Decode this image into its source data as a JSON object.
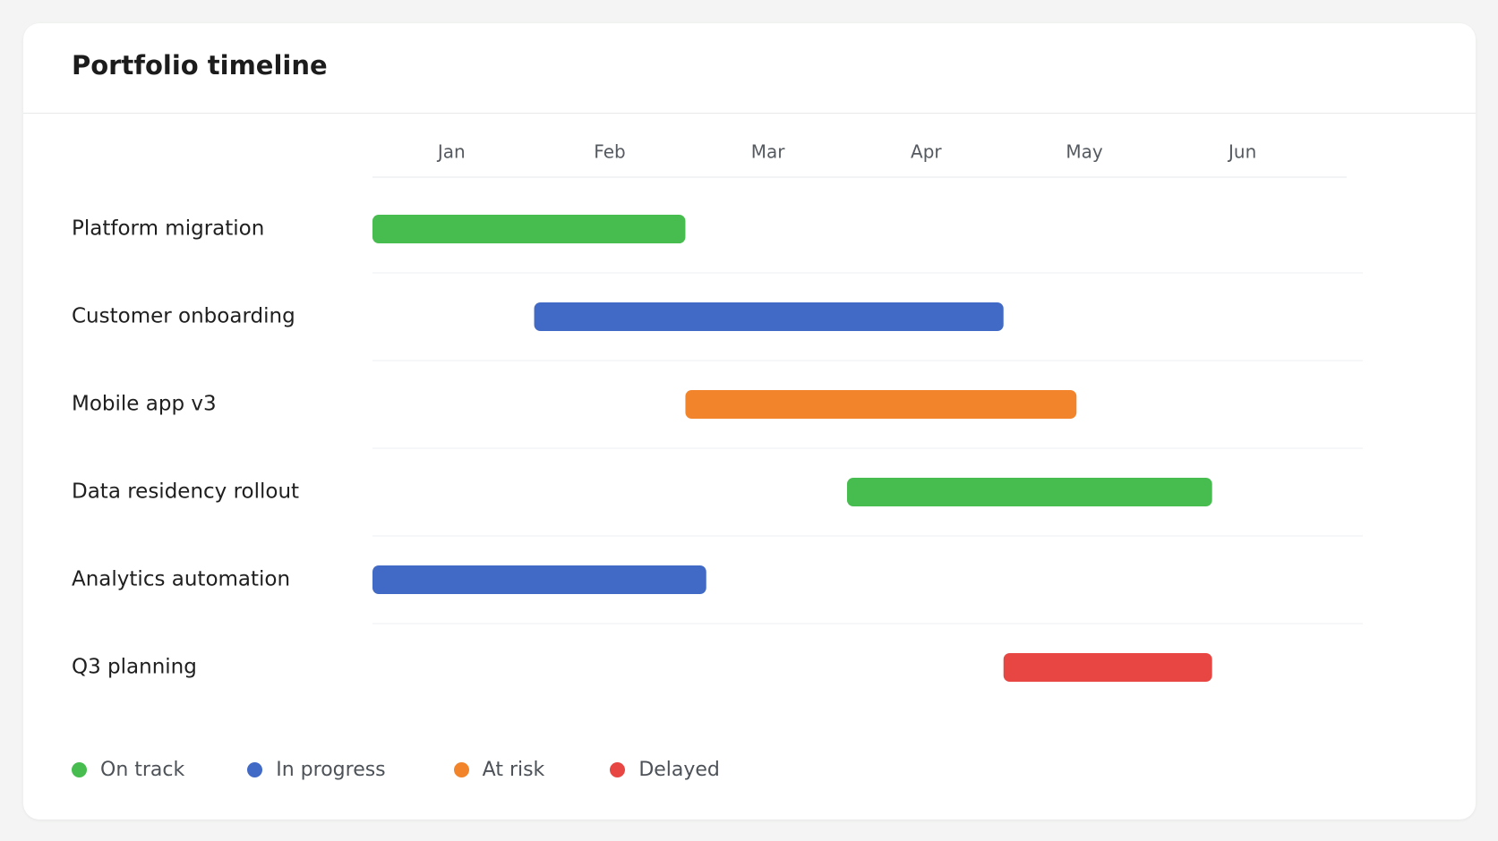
{
  "title": "Portfolio timeline",
  "colors": {
    "on_track": "#47bd4f",
    "in_progress": "#4169c6",
    "at_risk": "#f2852b",
    "delayed": "#e84642"
  },
  "chart_data": {
    "type": "gantt",
    "title": "Portfolio timeline",
    "months": [
      "Jan",
      "Feb",
      "Mar",
      "Apr",
      "May",
      "Jun"
    ],
    "tasks": [
      {
        "name": "Platform migration",
        "start": "2024-01-01",
        "end": "2024-03-01",
        "status": "on_track"
      },
      {
        "name": "Customer onboarding",
        "start": "2024-02-01",
        "end": "2024-05-01",
        "status": "in_progress"
      },
      {
        "name": "Mobile app v3",
        "start": "2024-03-01",
        "end": "2024-05-15",
        "status": "at_risk"
      },
      {
        "name": "Data residency rollout",
        "start": "2024-04-01",
        "end": "2024-06-10",
        "status": "on_track"
      },
      {
        "name": "Analytics automation",
        "start": "2024-01-01",
        "end": "2024-03-05",
        "status": "in_progress"
      },
      {
        "name": "Q3 planning",
        "start": "2024-05-01",
        "end": "2024-06-10",
        "status": "delayed"
      }
    ],
    "legend": [
      {
        "key": "on_track",
        "label": "On track"
      },
      {
        "key": "in_progress",
        "label": "In progress"
      },
      {
        "key": "at_risk",
        "label": "At risk"
      },
      {
        "key": "delayed",
        "label": "Delayed"
      }
    ],
    "legend_position": "bottom-left"
  }
}
